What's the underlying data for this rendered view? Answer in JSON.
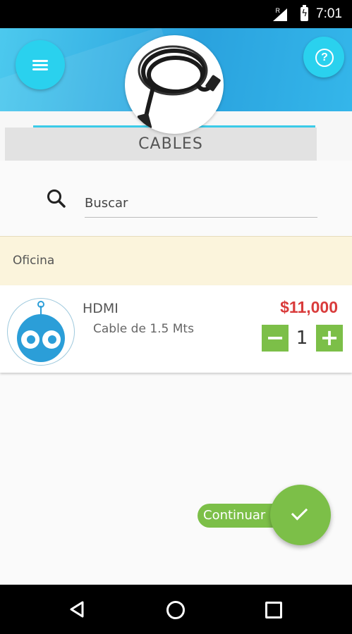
{
  "status_bar": {
    "time": "7:01",
    "network_type": "R"
  },
  "header": {
    "category_title": "CABLES",
    "menu_icon": "hamburger-menu-icon",
    "help_icon": "question-mark-icon",
    "accent_color": "#2ad1ee"
  },
  "search": {
    "placeholder": "Buscar",
    "icon": "search-icon"
  },
  "section": {
    "label": "Oficina"
  },
  "products": [
    {
      "name": "HDMI",
      "description": "Cable de 1.5 Mts",
      "price": "$11,000",
      "quantity": "1",
      "decrement_label": "−",
      "increment_label": "+"
    }
  ],
  "actions": {
    "continue_label": "Continuar",
    "continue_icon": "check-icon",
    "button_color": "#7cbf48"
  },
  "navigation": {
    "back_icon": "back-triangle-icon",
    "home_icon": "home-circle-icon",
    "recents_icon": "recents-square-icon"
  },
  "colors": {
    "price": "#d93b3b",
    "section_bg": "#fbf4dc",
    "header_gradient_start": "#4cc9ee",
    "header_gradient_end": "#2aa2de"
  }
}
